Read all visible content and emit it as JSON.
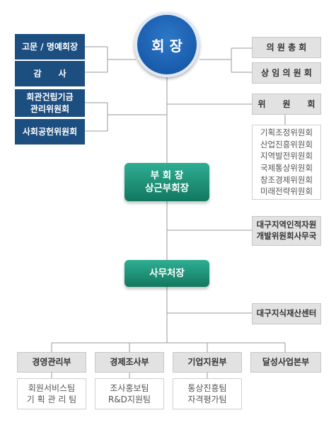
{
  "president": "회 장",
  "left_boxes": [
    "고문 / 명예회장",
    "감　　사",
    "회관건립기금 관리위원회",
    "사회공헌위원회"
  ],
  "right_boxes": [
    "의 원 총 회",
    "상 임 의 원 회",
    "위　　원　　회"
  ],
  "committees": [
    "기획조정위원회",
    "산업진흥위원회",
    "지역발전위원회",
    "국제통상위원회",
    "창조경제위원회",
    "미래전략위원회"
  ],
  "vice_president": {
    "line1": "부 회 장",
    "line2": "상근부회장"
  },
  "hr_office": {
    "line1": "대구지역인적자원",
    "line2": "개발위원회사무국"
  },
  "secretary_general": "사무처장",
  "ip_center": "대구지식재산센터",
  "departments": [
    {
      "name": "경영관리부",
      "teams": [
        "회원서비스팀",
        "기 획 관 리 팀"
      ]
    },
    {
      "name": "경제조사부",
      "teams": [
        "조사홍보팀",
        "R&D지원팀"
      ]
    },
    {
      "name": "기업지원부",
      "teams": [
        "통상진흥팀",
        "자격평가팀"
      ]
    },
    {
      "name": "달성사업본부",
      "teams": []
    }
  ]
}
